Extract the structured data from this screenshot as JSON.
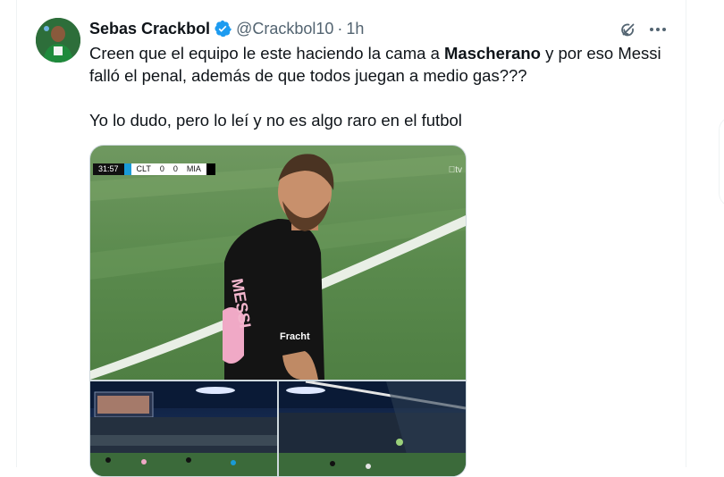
{
  "tweet": {
    "author": {
      "name": "Sebas Crackbol",
      "handle": "@Crackbol10",
      "separator": "·",
      "time": "1h"
    },
    "text": {
      "line1_before": "Creen que el equipo le este haciendo la cama a ",
      "line1_bold": "Mascherano",
      "line1_after": " y por eso Messi falló el penal, además de que todos juegan a medio gas???",
      "line2": "Yo lo dudo, pero lo leí y no es algo raro en el futbol"
    },
    "media": {
      "scorebug": {
        "clock": "31:57",
        "home": "CLT",
        "home_score": "0",
        "away_score": "0",
        "away": "MIA"
      },
      "broadcaster": "tv",
      "jersey_name": "MESSI",
      "jersey_sponsor": "Fracht"
    },
    "icons": {
      "verified": "verified-badge-icon",
      "grok": "grok-icon",
      "more": "more-icon"
    },
    "colors": {
      "verified": "#1d9bf0",
      "secondary_text": "#536471",
      "primary_text": "#0f1419"
    }
  }
}
